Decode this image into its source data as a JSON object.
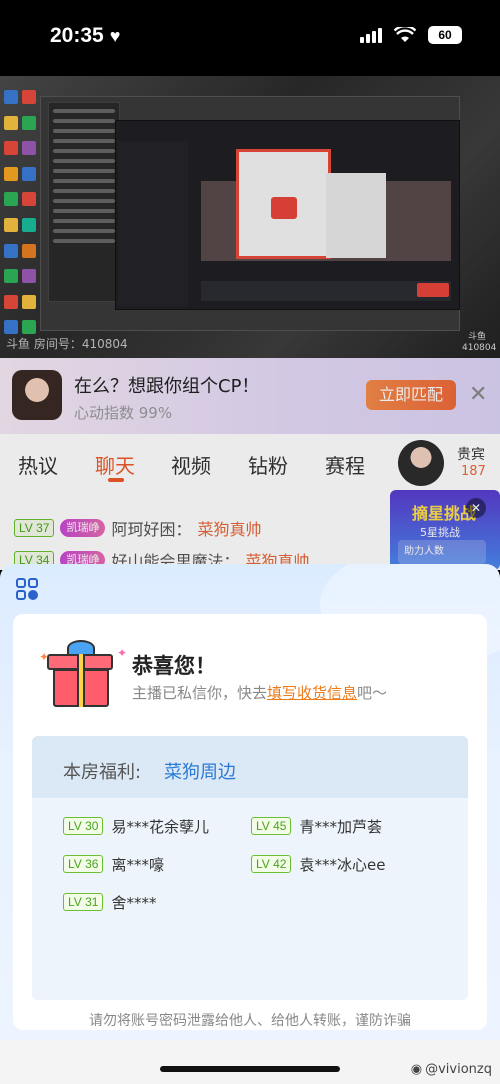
{
  "status_bar": {
    "time": "20:35",
    "battery": "60"
  },
  "video": {
    "watermark": "斗鱼 房间号：410804",
    "logo_text": "斗鱼 410804"
  },
  "cp_banner": {
    "title": "在么？想跟你组个CP！",
    "subtitle": "心动指数 99%",
    "button": "立即匹配",
    "close": "✕"
  },
  "tabs": [
    {
      "label": "热议"
    },
    {
      "label": "聊天"
    },
    {
      "label": "视频"
    },
    {
      "label": "钻粉"
    },
    {
      "label": "赛程"
    }
  ],
  "vip": {
    "label": "贵宾",
    "count": "187"
  },
  "chat": [
    {
      "level": "LV 37",
      "badge": "凯瑞峥",
      "text": "阿珂好困：",
      "highlight": "菜狗真帅"
    },
    {
      "level": "LV 34",
      "badge": "凯瑞峥",
      "text": "好山能会里魔法：",
      "highlight": "菜狗真帅"
    }
  ],
  "star_card": {
    "title": "摘星挑战",
    "sub": "5星挑战",
    "helper": "助力人数"
  },
  "modal": {
    "title": "恭喜您！",
    "message_prefix": "主播已私信你，快去",
    "message_link": "填写收货信息",
    "message_suffix": "吧～",
    "benefit_label": "本房福利:",
    "benefit_name": "菜狗周边",
    "winners": [
      {
        "level": "LV 30",
        "name": "易***花余孽儿"
      },
      {
        "level": "LV 45",
        "name": "青***加芦荟"
      },
      {
        "level": "LV 36",
        "name": "离***嚎"
      },
      {
        "level": "LV 42",
        "name": "袁***冰心ee"
      },
      {
        "level": "LV 31",
        "name": "舍****"
      }
    ],
    "warning": "请勿将账号密码泄露给他人、给他人转账，谨防诈骗"
  },
  "footer": {
    "weibo": "@vivionzq"
  },
  "colors": {
    "accent": "#ee5a2a",
    "link": "#2a7ad6",
    "level_green": "#4aa31e"
  }
}
